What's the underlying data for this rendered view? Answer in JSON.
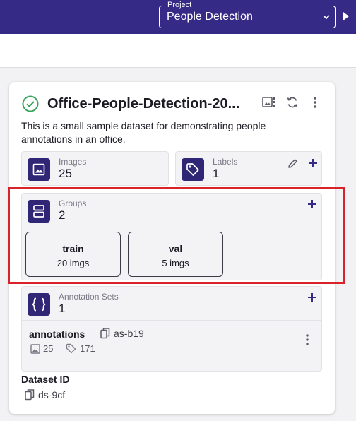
{
  "topbar": {
    "project_legend": "Project",
    "project_value": "People Detection"
  },
  "dataset": {
    "status_icon": "check-circle-icon",
    "title": "Office-People-Detection-20...",
    "description": "This is a small sample dataset for demonstrating people annotations in an office.",
    "images": {
      "label": "Images",
      "count": "25"
    },
    "labels": {
      "label": "Labels",
      "count": "1"
    },
    "groups": {
      "label": "Groups",
      "count": "2",
      "items": [
        {
          "name": "train",
          "count": "20 imgs"
        },
        {
          "name": "val",
          "count": "5 imgs"
        }
      ]
    },
    "annotation_sets": {
      "label": "Annotation Sets",
      "count": "1",
      "items": [
        {
          "name": "annotations",
          "id": "as-b19",
          "images": "25",
          "labels": "171"
        }
      ]
    },
    "dataset_id": {
      "label": "Dataset ID",
      "value": "ds-9cf"
    }
  },
  "colors": {
    "brand": "#352a85",
    "badge": "#2f2775",
    "success": "#3aa55a",
    "highlight": "#d8232a"
  }
}
